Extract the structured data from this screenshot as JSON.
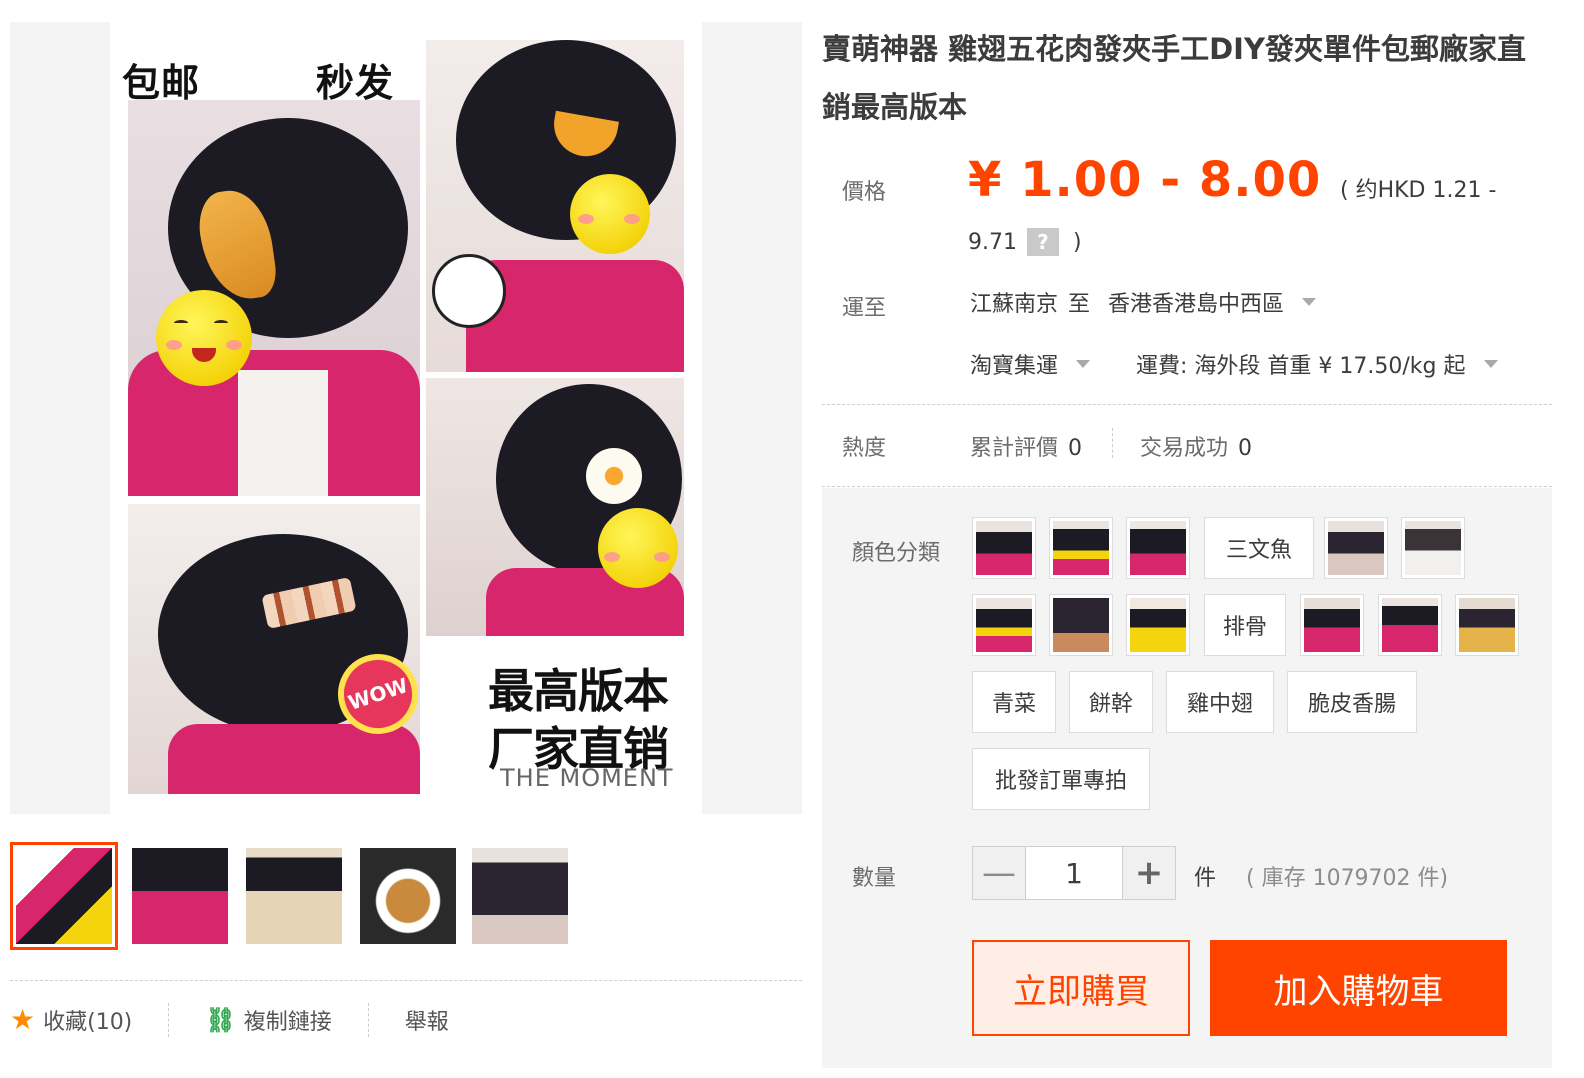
{
  "product": {
    "title": "賣萌神器 雞翅五花肉發夾手工DIY發夾單件包郵廠家直銷最高版本"
  },
  "main_image": {
    "tag_left": "包邮",
    "tag_right": "秒发",
    "wow_sticker": "WOW",
    "slogan_line1": "最高版本",
    "slogan_line2": "厂家直销",
    "slogan_sub": "THE MOMENT"
  },
  "social": {
    "favorite": "收藏(10)",
    "copy_link": "複制鏈接",
    "report": "舉報"
  },
  "price": {
    "label": "價格",
    "range": "¥ 1.00 - 8.00",
    "hkd_part1": "( 约HKD 1.21 -",
    "hkd_part2": "9.71",
    "help": "?",
    "close_paren": ")"
  },
  "shipping": {
    "label": "運至",
    "origin": "江蘇南京",
    "to_word": "至",
    "destination": "香港香港島中西區",
    "method": "淘寶集運",
    "fee": "運費: 海外段 首重 ¥ 17.50/kg 起"
  },
  "heat": {
    "label": "熱度",
    "reviews_label": "累計評價",
    "reviews_value": "0",
    "sales_label": "交易成功",
    "sales_value": "0"
  },
  "sku": {
    "label": "顏色分類",
    "text_options": [
      "三文魚",
      "排骨",
      "青菜",
      "餅幹",
      "雞中翅",
      "脆皮香腸",
      "批發訂單專拍"
    ]
  },
  "quantity": {
    "label": "數量",
    "minus": "—",
    "value": "1",
    "plus": "+",
    "unit": "件",
    "stock": "( 庫存 1079702 件)"
  },
  "actions": {
    "buy_now": "立即購買",
    "add_to_cart": "加入購物車"
  },
  "colors": {
    "accent": "#ff4400",
    "favorite_star": "#ff8a00",
    "link_icon": "#2fa84f"
  }
}
